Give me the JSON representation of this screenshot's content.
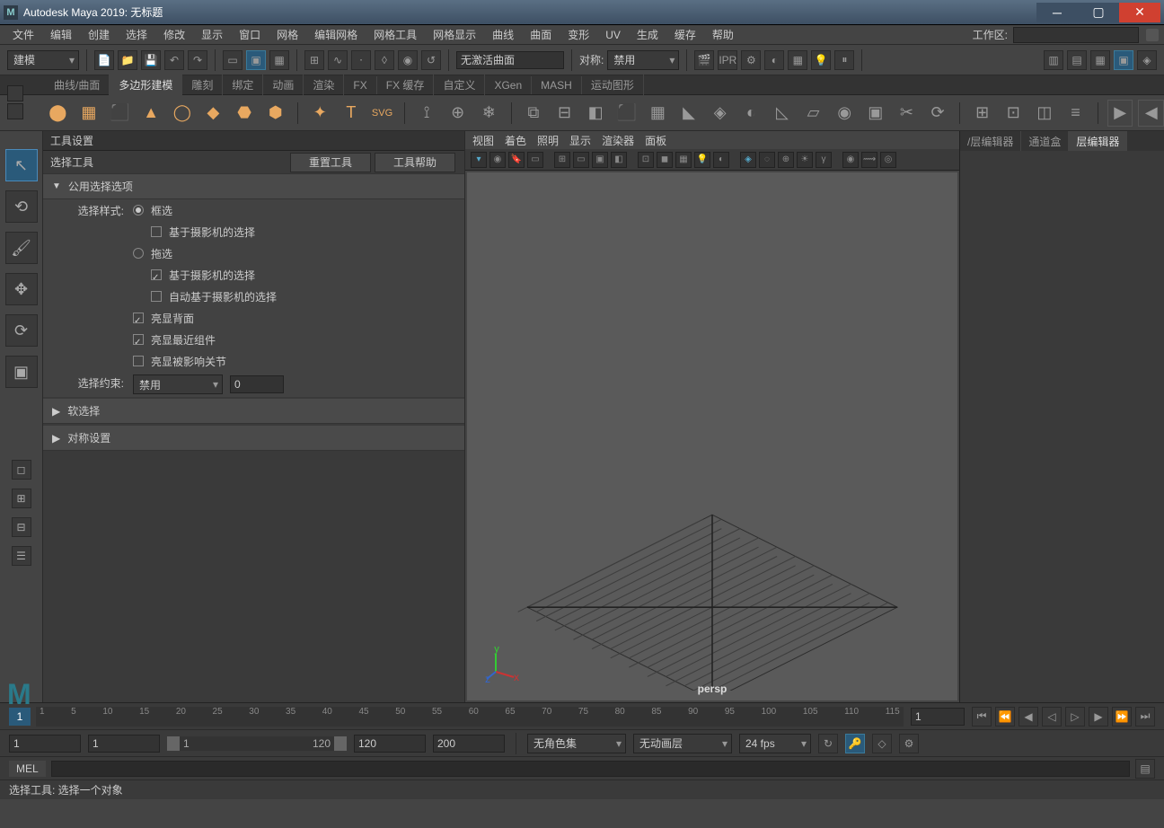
{
  "title": "Autodesk Maya 2019: 无标题",
  "menus": [
    "文件",
    "编辑",
    "创建",
    "选择",
    "修改",
    "显示",
    "窗口",
    "网格",
    "编辑网格",
    "网格工具",
    "网格显示",
    "曲线",
    "曲面",
    "变形",
    "UV",
    "生成",
    "缓存",
    "帮助"
  ],
  "workspace_label": "工作区:",
  "mode_dropdown": "建模",
  "status_no_curve": "无激活曲面",
  "sym_label": "对称:",
  "sym_value": "禁用",
  "shelf_tabs": [
    "曲线/曲面",
    "多边形建模",
    "雕刻",
    "绑定",
    "动画",
    "渲染",
    "FX",
    "FX 缓存",
    "自定义",
    "XGen",
    "MASH",
    "运动图形"
  ],
  "shelf_active": 1,
  "tool_settings": {
    "panel_title": "工具设置",
    "tool_name": "选择工具",
    "reset_btn": "重置工具",
    "help_btn": "工具帮助",
    "sec1": "公用选择选项",
    "select_style_label": "选择样式:",
    "opt_marquee": "框选",
    "opt_cam_based": "基于摄影机的选择",
    "opt_drag": "拖选",
    "opt_cam_based2": "基于摄影机的选择",
    "opt_auto_cam": "自动基于摄影机的选择",
    "opt_backface": "亮显背面",
    "opt_nearest": "亮显最近组件",
    "opt_affected": "亮显被影响关节",
    "constraint_label": "选择约束:",
    "constraint_val": "禁用",
    "constraint_num": "0",
    "sec_soft": "软选择",
    "sec_sym": "对称设置"
  },
  "viewport": {
    "menus": [
      "视图",
      "着色",
      "照明",
      "显示",
      "渲染器",
      "面板"
    ],
    "camera": "persp"
  },
  "right_tabs": [
    "/层编辑器",
    "通道盒",
    "层编辑器"
  ],
  "right_active": 2,
  "timeline": {
    "current": "1",
    "ticks": [
      "1",
      "5",
      "10",
      "15",
      "20",
      "25",
      "30",
      "35",
      "40",
      "45",
      "50",
      "55",
      "60",
      "65",
      "70",
      "75",
      "80",
      "85",
      "90",
      "95",
      "100",
      "105",
      "110",
      "115"
    ],
    "endframe": "1"
  },
  "range": {
    "start": "1",
    "in": "1",
    "out": "120",
    "end": "120",
    "rangeEnd": "200",
    "charset": "无角色集",
    "animlayer": "无动画层",
    "fps": "24 fps"
  },
  "mel_label": "MEL",
  "status_text": "选择工具: 选择一个对象"
}
